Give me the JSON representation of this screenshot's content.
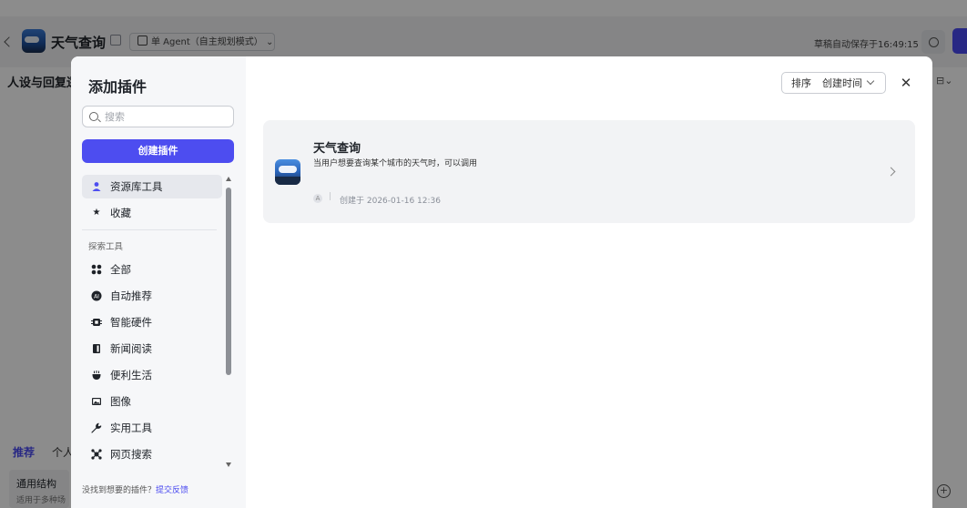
{
  "header": {
    "title": "天气查询",
    "mode": "单 Agent（自主规划模式）",
    "save_status": "草稿自动保存于16:49:15"
  },
  "background": {
    "left_heading": "人设与回复逻",
    "tabs": [
      "推荐",
      "个人"
    ],
    "card": {
      "title": "通用结构",
      "desc": "适用于多种场"
    }
  },
  "modal": {
    "title": "添加插件",
    "search_placeholder": "搜索",
    "create_button": "创建插件",
    "nav_items": [
      {
        "label": "资源库工具",
        "icon": "user-icon",
        "active": true
      },
      {
        "label": "收藏",
        "icon": "star-icon",
        "active": false
      }
    ],
    "section_label": "探索工具",
    "explore_items": [
      {
        "label": "全部",
        "icon": "grid-icon"
      },
      {
        "label": "自动推荐",
        "icon": "ai-icon"
      },
      {
        "label": "智能硬件",
        "icon": "chip-icon"
      },
      {
        "label": "新闻阅读",
        "icon": "book-icon"
      },
      {
        "label": "便利生活",
        "icon": "cup-icon"
      },
      {
        "label": "图像",
        "icon": "image-icon"
      },
      {
        "label": "实用工具",
        "icon": "wrench-icon"
      },
      {
        "label": "网页搜索",
        "icon": "web-search-icon"
      }
    ],
    "feedback_text": "没找到想要的插件？",
    "feedback_link": "提交反馈",
    "sort_label": "排序",
    "sort_value": "创建时间",
    "plugin": {
      "name": "天气查询",
      "description": "当用户想要查询某个城市的天气时，可以调用",
      "author_initial": "A",
      "separator": "|",
      "created": "创建于 2026-01-16 12:36"
    }
  },
  "colors": {
    "accent": "#4d4df0",
    "overlay": "rgba(0,0,0,0.45)"
  }
}
